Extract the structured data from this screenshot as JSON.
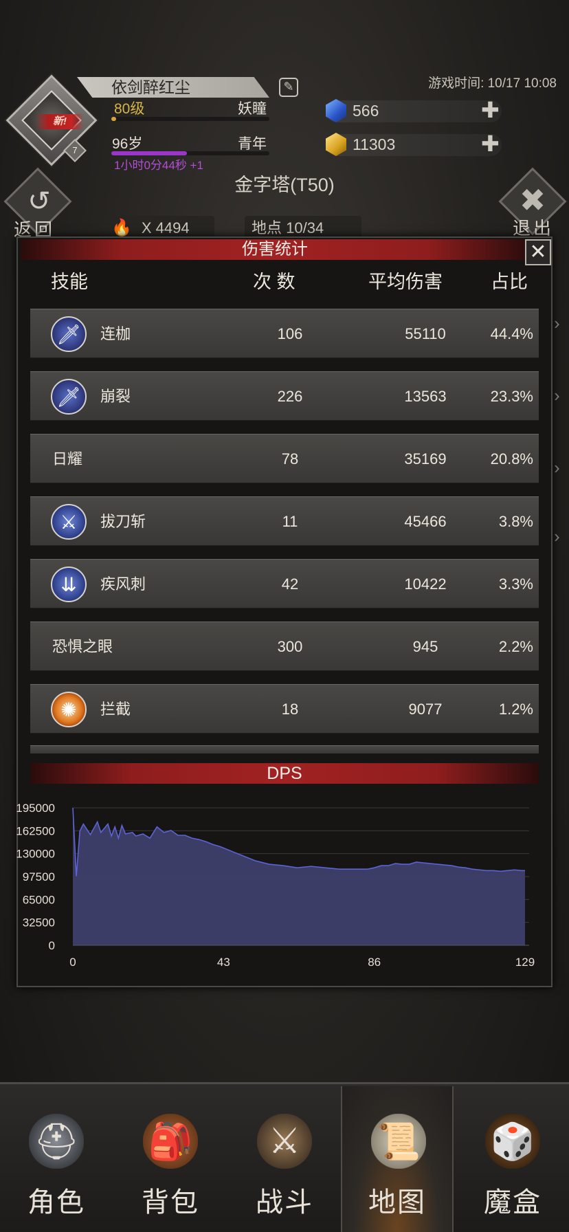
{
  "player": {
    "name": "依剑醉红尘",
    "new_badge": "新!",
    "avatar_level": "7",
    "level": "80级",
    "race": "妖瞳",
    "age": "96岁",
    "stage": "青年",
    "timer": "1小时0分44秒 +1",
    "exp_progress": 0.03,
    "age_progress": 0.48
  },
  "game_time": "游戏时间: 10/17 10:08",
  "resources": {
    "blue_gem": "566",
    "gold_gem": "11303"
  },
  "location": {
    "title": "金字塔(T50)",
    "back_label": "返回",
    "exit_label": "退出",
    "torch_count": "X 4494",
    "progress": "地点 10/34"
  },
  "damage_panel": {
    "title": "伤害统计",
    "close": "✕",
    "headers": {
      "skill": "技能",
      "count": "次 数",
      "avg": "平均伤害",
      "ratio": "占比"
    },
    "rows": [
      {
        "name": "连枷",
        "count": "106",
        "avg": "55110",
        "ratio": "44.4%",
        "icon": "sword-skill-icon"
      },
      {
        "name": "崩裂",
        "count": "226",
        "avg": "13563",
        "ratio": "23.3%",
        "icon": "sword-skill-icon"
      },
      {
        "name": "日耀",
        "count": "78",
        "avg": "35169",
        "ratio": "20.8%",
        "icon": ""
      },
      {
        "name": "拔刀斩",
        "count": "11",
        "avg": "45466",
        "ratio": "3.8%",
        "icon": "slash-skill-icon"
      },
      {
        "name": "疾风刺",
        "count": "42",
        "avg": "10422",
        "ratio": "3.3%",
        "icon": "blade-rain-skill-icon"
      },
      {
        "name": "恐惧之眼",
        "count": "300",
        "avg": "945",
        "ratio": "2.2%",
        "icon": ""
      },
      {
        "name": "拦截",
        "count": "18",
        "avg": "9077",
        "ratio": "1.2%",
        "icon": "fire-skill-icon"
      }
    ]
  },
  "chart_data": {
    "type": "area",
    "title": "DPS",
    "xlabel": "",
    "ylabel": "",
    "xlim": [
      0,
      129
    ],
    "ylim": [
      0,
      195000
    ],
    "x_ticks": [
      "0",
      "43",
      "86",
      "129"
    ],
    "y_ticks": [
      "0",
      "32500",
      "65000",
      "97500",
      "130000",
      "162500",
      "195000"
    ],
    "grid": true,
    "color": "#3d3f6b",
    "line_color": "#5b63d6",
    "x": [
      0,
      1,
      2,
      3,
      5,
      7,
      8,
      10,
      11,
      12,
      13,
      14,
      15,
      17,
      18,
      20,
      22,
      24,
      26,
      28,
      30,
      32,
      34,
      36,
      38,
      40,
      42,
      45,
      48,
      52,
      56,
      60,
      64,
      68,
      72,
      76,
      80,
      84,
      86,
      88,
      90,
      92,
      94,
      96,
      98,
      100,
      102,
      104,
      106,
      108,
      110,
      112,
      114,
      116,
      118,
      120,
      122,
      124,
      126,
      128,
      129
    ],
    "y": [
      195000,
      98000,
      162000,
      172000,
      157000,
      175000,
      160000,
      172000,
      155000,
      168000,
      152000,
      170000,
      158000,
      160000,
      155000,
      158000,
      152000,
      168000,
      160000,
      163000,
      156000,
      156000,
      152000,
      150000,
      147000,
      143000,
      140000,
      134000,
      128000,
      120000,
      115000,
      113000,
      110000,
      112000,
      110000,
      108000,
      108000,
      108000,
      110000,
      113000,
      113000,
      116000,
      115000,
      115000,
      118000,
      117000,
      116000,
      115000,
      114000,
      113000,
      111000,
      110000,
      108000,
      107000,
      106000,
      106000,
      105000,
      106000,
      107000,
      106000,
      106000
    ]
  },
  "tabs": [
    {
      "label": "角色",
      "icon": "helmet-icon",
      "active": false
    },
    {
      "label": "背包",
      "icon": "backpack-icon",
      "active": false
    },
    {
      "label": "战斗",
      "icon": "sword-shield-icon",
      "active": false
    },
    {
      "label": "地图",
      "icon": "scroll-map-icon",
      "active": true
    },
    {
      "label": "魔盒",
      "icon": "magic-box-icon",
      "active": false
    }
  ]
}
